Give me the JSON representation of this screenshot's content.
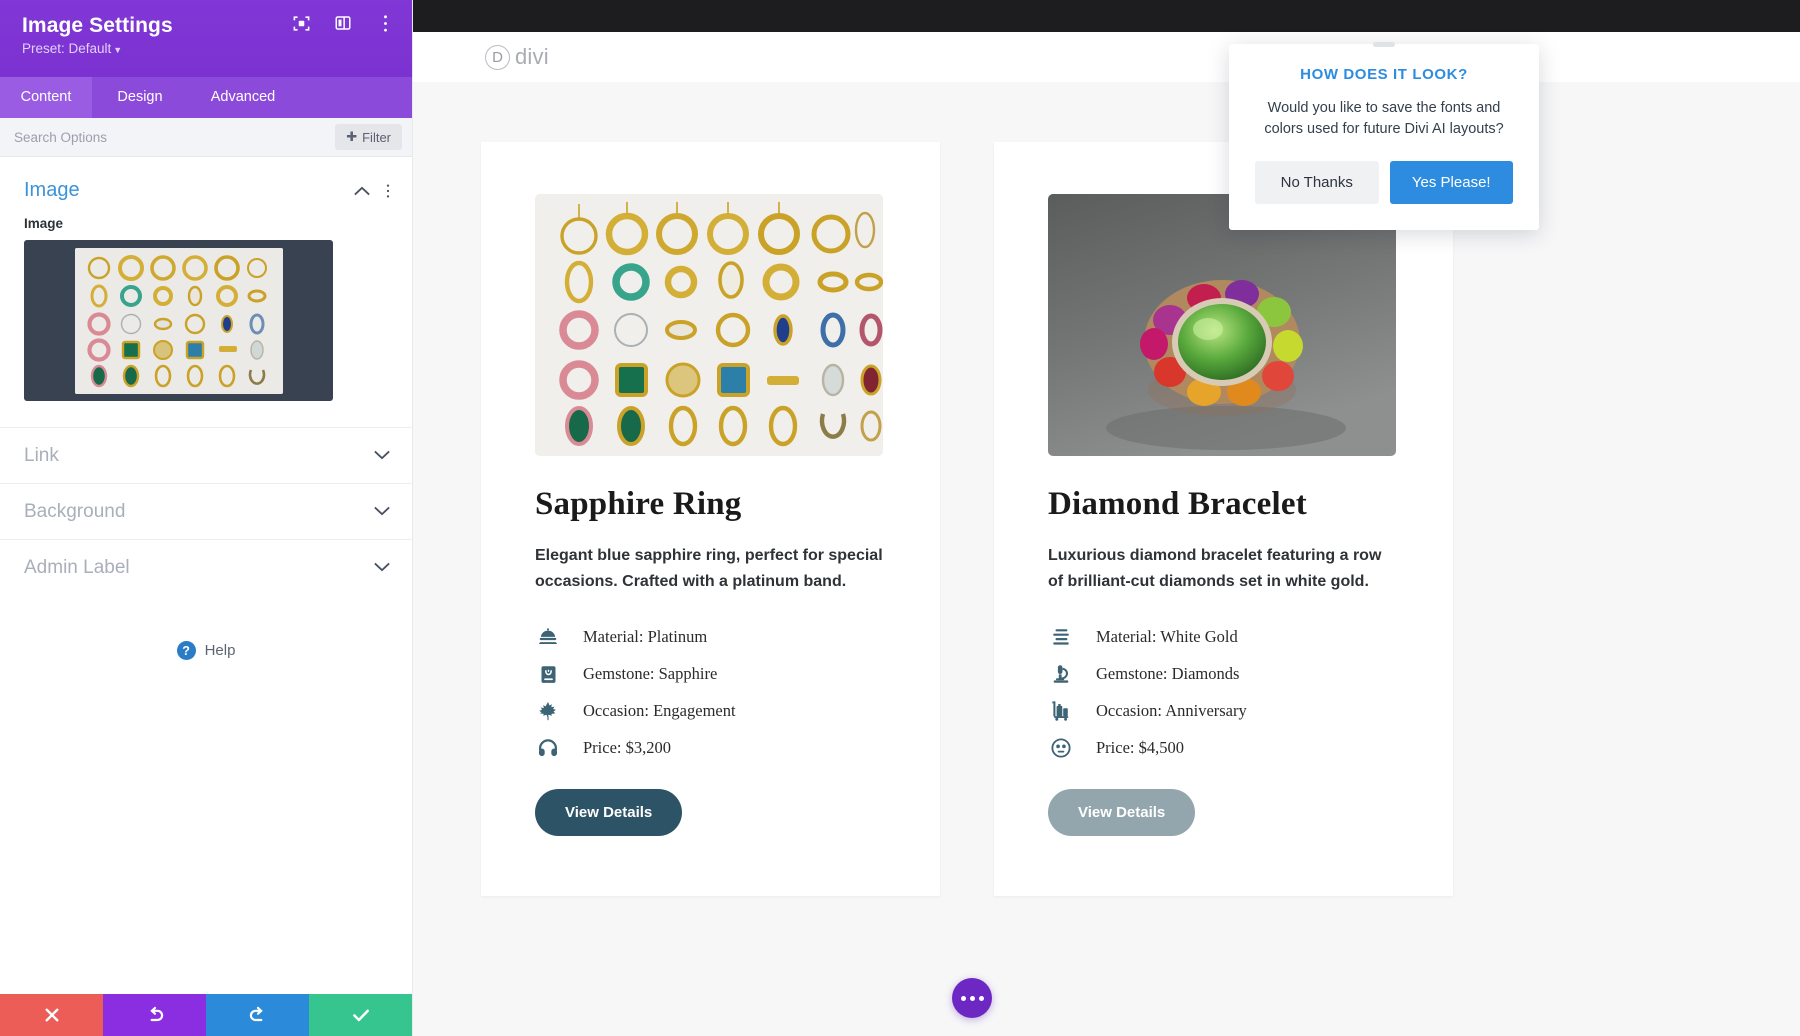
{
  "settings_panel": {
    "title": "Image Settings",
    "preset_label": "Preset: Default",
    "header_icons": [
      "focus-target-icon",
      "panel-layout-icon",
      "more-vertical-icon"
    ],
    "tabs": [
      {
        "label": "Content",
        "active": true
      },
      {
        "label": "Design",
        "active": false
      },
      {
        "label": "Advanced",
        "active": false
      }
    ],
    "search": {
      "placeholder": "Search Options",
      "value": ""
    },
    "filter_label": "Filter",
    "open_section": {
      "title": "Image",
      "field_label": "Image"
    },
    "collapsed_sections": [
      {
        "label": "Link"
      },
      {
        "label": "Background"
      },
      {
        "label": "Admin Label"
      }
    ],
    "help_label": "Help",
    "footer_actions": [
      {
        "name": "cancel",
        "icon": "close-icon",
        "color": "#eb5d56"
      },
      {
        "name": "undo",
        "icon": "undo-icon",
        "color": "#8b2de0"
      },
      {
        "name": "redo",
        "icon": "redo-icon",
        "color": "#2b8ad9"
      },
      {
        "name": "save",
        "icon": "check-icon",
        "color": "#36c48f"
      }
    ]
  },
  "site": {
    "logo_text": "divi",
    "logo_mark": "D",
    "fab_label": "more-options"
  },
  "cards": [
    {
      "title": "Sapphire Ring",
      "description": "Elegant blue sapphire ring, perfect for special occasions. Crafted with a platinum band.",
      "image_alt": "gold-jewelry-grid",
      "features": [
        {
          "icon": "bell-dome-icon",
          "text": "Material: Platinum"
        },
        {
          "icon": "book-icon",
          "text": "Gemstone: Sapphire"
        },
        {
          "icon": "maple-leaf-icon",
          "text": "Occasion: Engagement"
        },
        {
          "icon": "headphones-icon",
          "text": "Price: $3,200"
        }
      ],
      "cta_label": "View Details",
      "cta_style": "primary"
    },
    {
      "title": "Diamond Bracelet",
      "description": "Luxurious diamond bracelet featuring a row of brilliant-cut diamonds set in white gold.",
      "image_alt": "gemstone-cocktail-ring",
      "features": [
        {
          "icon": "align-lines-icon",
          "text": "Material: White Gold"
        },
        {
          "icon": "microscope-icon",
          "text": "Gemstone: Diamonds"
        },
        {
          "icon": "luggage-cart-icon",
          "text": "Occasion: Anniversary"
        },
        {
          "icon": "face-icon",
          "text": "Price: $4,500"
        }
      ],
      "cta_label": "View Details",
      "cta_style": "muted"
    }
  ],
  "ai_dialog": {
    "title": "HOW DOES IT LOOK?",
    "message": "Would you like to save the fonts and colors used for future Divi AI layouts?",
    "decline_label": "No Thanks",
    "accept_label": "Yes Please!"
  },
  "colors": {
    "panel_purple": "#7e3bd0",
    "tab_bar": "#8c4ada",
    "accent_blue": "#3b93d9",
    "dialog_blue": "#2d8ce0",
    "cta_primary": "#2d5366",
    "cta_muted": "#93a5ad",
    "icon_teal": "#3d6374"
  }
}
